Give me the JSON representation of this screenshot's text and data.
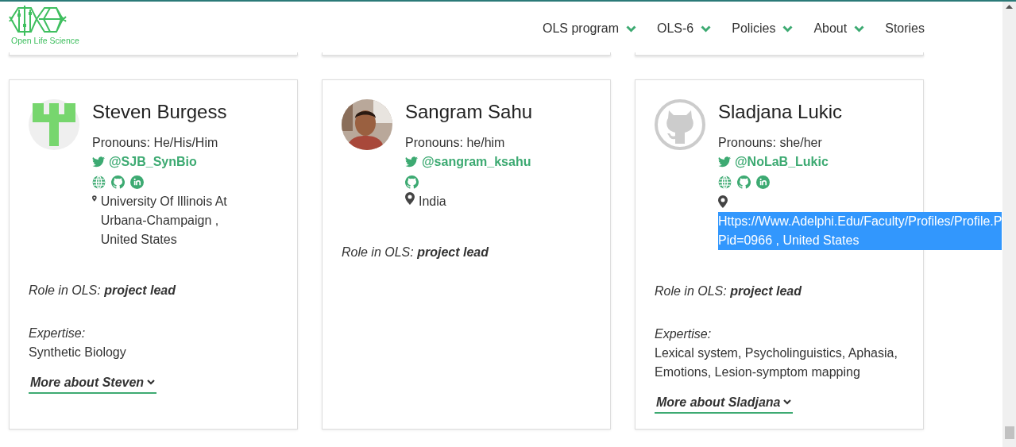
{
  "logo": {
    "text": "Open Life Science"
  },
  "nav": [
    {
      "label": "OLS program",
      "dropdown": true
    },
    {
      "label": "OLS-6",
      "dropdown": true
    },
    {
      "label": "Policies",
      "dropdown": true
    },
    {
      "label": "About",
      "dropdown": true
    },
    {
      "label": "Stories",
      "dropdown": false
    }
  ],
  "people": [
    {
      "name": "Steven Burgess",
      "avatar": {
        "kind": "identicon"
      },
      "pronouns": "Pronouns: He/His/Him",
      "twitter": "@SJB_SynBio",
      "links": [
        {
          "kind": "web"
        },
        {
          "kind": "github"
        },
        {
          "kind": "linkedin"
        }
      ],
      "location": [
        "University Of Illinois At Urbana-Champaign , United States"
      ],
      "location_highlighted": false,
      "role": "Role in OLS: **project lead**",
      "expertise_label": "Expertise:",
      "expertise": "Synthetic Biology",
      "more": "More about Steven"
    },
    {
      "name": "Sangram Sahu",
      "avatar": {
        "kind": "picture"
      },
      "pronouns": "Pronouns: he/him",
      "twitter": "@sangram_ksahu",
      "links": [
        {
          "kind": "github"
        }
      ],
      "location": [
        "India"
      ],
      "location_highlighted": false,
      "role": "Role in OLS: **project lead**"
    },
    {
      "name": "Sladjana Lukic",
      "avatar": {
        "kind": "octocat"
      },
      "pronouns": "Pronouns: she/her",
      "twitter": "@NoLaB_Lukic",
      "links": [
        {
          "kind": "web"
        },
        {
          "kind": "github"
        },
        {
          "kind": "linkedin"
        }
      ],
      "location": [
        "Https://Www.Adelphi.Edu/Faculty/Profiles/Profile.P",
        "Pid=0966 , United States"
      ],
      "location_highlighted": true,
      "role": "Role in OLS: **project lead**",
      "expertise_label": "Expertise:",
      "expertise": "Lexical system, Psycholinguistics, Aphasia, Emotions, Lesion-symptom mapping",
      "more": "More about Sladjana"
    }
  ]
}
